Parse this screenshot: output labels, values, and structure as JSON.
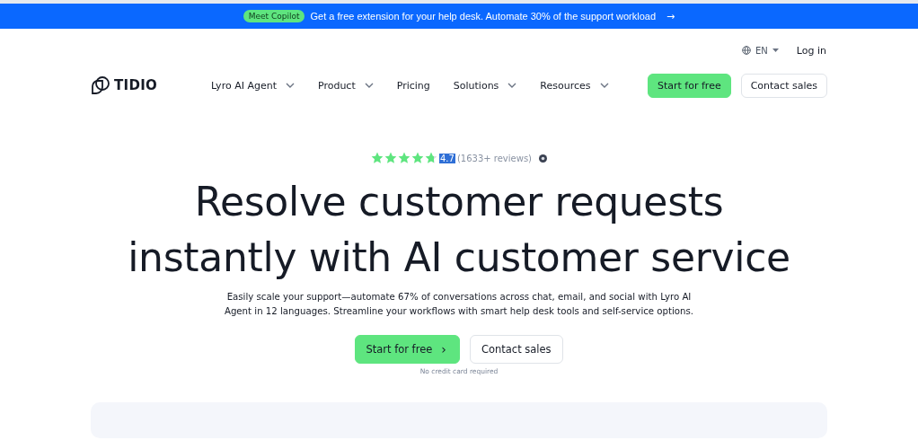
{
  "banner": {
    "badge": "Meet Copilot",
    "text": "Get a free extension for your help desk. Automate 30% of the support workload",
    "arrow": "→"
  },
  "utility": {
    "language": "EN",
    "login": "Log in"
  },
  "nav": {
    "logo": "TIDIO",
    "items": [
      {
        "label": "Lyro AI Agent",
        "dropdown": true
      },
      {
        "label": "Product",
        "dropdown": true
      },
      {
        "label": "Pricing",
        "dropdown": false
      },
      {
        "label": "Solutions",
        "dropdown": true
      },
      {
        "label": "Resources",
        "dropdown": true
      }
    ],
    "buttons": [
      {
        "label": "Start for free",
        "kind": "primary"
      },
      {
        "label": "Contact sales",
        "kind": "secondary"
      }
    ]
  },
  "hero": {
    "rating": {
      "stars": 4.7,
      "score": "4.7",
      "score_highlighted": true,
      "reviews": "(1633+ reviews)"
    },
    "title_lines": [
      "Resolve customer requests",
      "instantly with AI customer service"
    ],
    "subtitle": "Easily scale your support—automate 67% of conversations across chat, email, and social with Lyro AI Agent in 12 languages. Streamline your workflows with smart help desk tools and self-service options.",
    "buttons": [
      {
        "label": "Start for free",
        "kind": "primary",
        "chevron": "›"
      },
      {
        "label": "Contact sales",
        "kind": "secondary"
      }
    ],
    "note": "No credit card required"
  }
}
